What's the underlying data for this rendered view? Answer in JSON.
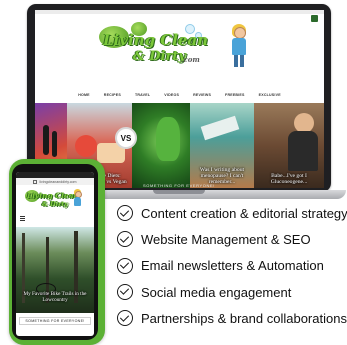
{
  "laptop_site": {
    "logo": {
      "line1": "Living Clean",
      "line2": "& Dirty",
      "suffix": ".com"
    },
    "nav": [
      "HOME",
      "RECIPES",
      "TRAVEL",
      "VIDEOS",
      "REVIEWS",
      "FREEBIES",
      "EXCLUSIVE"
    ],
    "versus_badge": "VS",
    "tiles": [
      {
        "caption": ""
      },
      {
        "caption": "Battle of the Diets: Mediterranean vs Vegan"
      },
      {
        "caption": ""
      },
      {
        "caption": "Was I writing about menopause? I can't remember..."
      },
      {
        "caption": "Babe...I've got I Gluconeogene..."
      }
    ],
    "footer_text": "SOMETHING FOR EVERYONE!"
  },
  "phone_site": {
    "url": "livingcleananddirty.com",
    "logo": {
      "line1": "Living Clean",
      "line2": "& Dirty"
    },
    "hero_caption": "My Favorite Bike Trails in the Lowcountry",
    "footer_text": "SOMETHING FOR EVERYONE!"
  },
  "services": [
    "Content creation & editorial strategy",
    "Website Management & SEO",
    "Email newsletters & Automation",
    "Social media engagement",
    "Partnerships & brand collaborations"
  ]
}
